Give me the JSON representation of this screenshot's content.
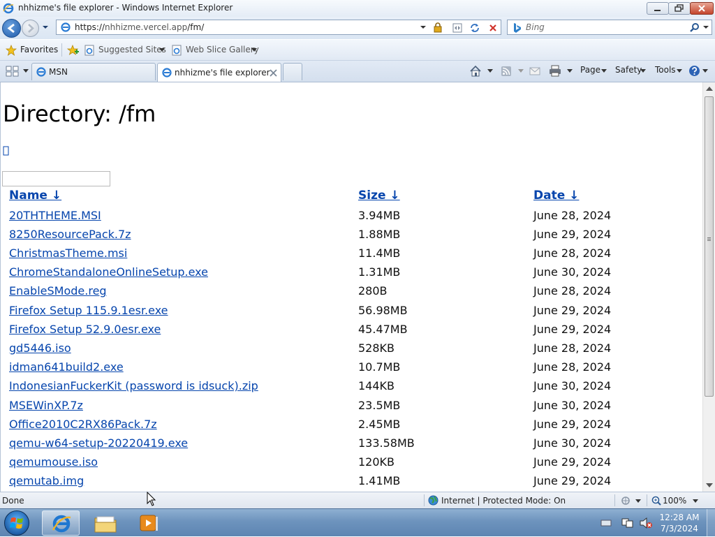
{
  "window": {
    "title": "nhhizme's file explorer - Windows Internet Explorer"
  },
  "address_bar": {
    "url_scheme": "https://",
    "url_host": "nhhizme.vercel.app",
    "url_path": "/fm/"
  },
  "search": {
    "placeholder": "Bing"
  },
  "favorites_bar": {
    "favorites_label": "Favorites",
    "suggested_sites_label": "Suggested Sites",
    "web_slice_gallery_label": "Web Slice Gallery"
  },
  "tabs": [
    {
      "label": "MSN"
    },
    {
      "label": "nhhizme's file explorer"
    }
  ],
  "command_bar": {
    "page_label": "Page",
    "safety_label": "Safety",
    "tools_label": "Tools"
  },
  "page": {
    "heading": "Directory: /fm",
    "up_link": "",
    "columns": {
      "name": "Name ↓",
      "size": "Size ↓",
      "date": "Date ↓"
    },
    "files": [
      {
        "name": "20THTHEME.MSI",
        "size": "3.94MB",
        "date": "June 28, 2024"
      },
      {
        "name": "8250ResourcePack.7z",
        "size": "1.88MB",
        "date": "June 29, 2024"
      },
      {
        "name": "ChristmasTheme.msi",
        "size": "11.4MB",
        "date": "June 28, 2024"
      },
      {
        "name": "ChromeStandaloneOnlineSetup.exe",
        "size": "1.31MB",
        "date": "June 30, 2024"
      },
      {
        "name": "EnableSMode.reg",
        "size": "280B",
        "date": "June 28, 2024"
      },
      {
        "name": "Firefox Setup 115.9.1esr.exe",
        "size": "56.98MB",
        "date": "June 29, 2024"
      },
      {
        "name": "Firefox Setup 52.9.0esr.exe",
        "size": "45.47MB",
        "date": "June 29, 2024"
      },
      {
        "name": "gd5446.iso",
        "size": "528KB",
        "date": "June 28, 2024"
      },
      {
        "name": "idman641build2.exe",
        "size": "10.7MB",
        "date": "June 28, 2024"
      },
      {
        "name": "IndonesianFuckerKit (password is idsuck).zip",
        "size": "144KB",
        "date": "June 30, 2024"
      },
      {
        "name": "MSEWinXP.7z",
        "size": "23.5MB",
        "date": "June 30, 2024"
      },
      {
        "name": "Office2010C2RX86Pack.7z",
        "size": "2.45MB",
        "date": "June 29, 2024"
      },
      {
        "name": "qemu-w64-setup-20220419.exe",
        "size": "133.58MB",
        "date": "June 30, 2024"
      },
      {
        "name": "qemumouse.iso",
        "size": "120KB",
        "date": "June 29, 2024"
      },
      {
        "name": "qemutab.img",
        "size": "1.41MB",
        "date": "June 29, 2024"
      }
    ]
  },
  "status_bar": {
    "status_text": "Done",
    "zone_text": "Internet | Protected Mode: On",
    "zoom_text": "100%"
  },
  "taskbar": {
    "time": "12:28 AM",
    "date": "7/3/2024"
  },
  "icons": {
    "ie": "ie-icon",
    "back": "back-arrow-icon",
    "forward": "forward-arrow-icon",
    "lock": "lock-icon",
    "refresh": "refresh-icon",
    "stop": "stop-icon",
    "search": "magnifier-icon",
    "star": "star-icon",
    "home": "home-icon",
    "feeds": "rss-icon",
    "mail": "mail-icon",
    "print": "print-icon",
    "help": "help-icon",
    "globe": "globe-icon",
    "folder": "folder-icon",
    "media": "media-player-icon"
  },
  "colors": {
    "link": "#0645ad",
    "chrome_blue": "#dbe6f3",
    "taskbar": "#6d93bd"
  }
}
